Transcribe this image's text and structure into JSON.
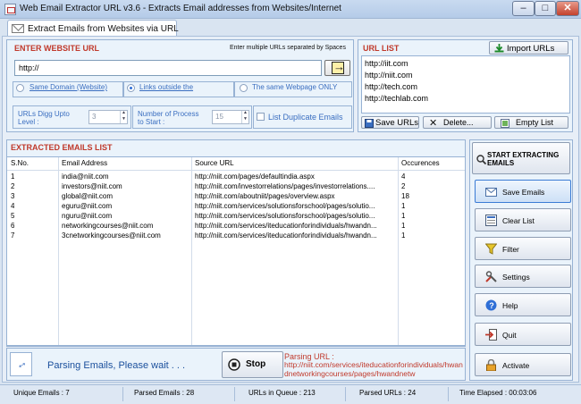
{
  "window": {
    "title": "Web Email Extractor URL v3.6 - Extracts Email addresses from Websites/Internet",
    "minimize": "–",
    "maximize": "□",
    "close": "✕"
  },
  "tab": {
    "label": "Extract Emails from Websites via URL"
  },
  "enter_url": {
    "title": "ENTER WEBSITE URL",
    "hint": "Enter multiple URLs separated by Spaces",
    "input_value": "http://",
    "radios": [
      {
        "label": "Same Domain (Website)",
        "checked": false
      },
      {
        "label": "Links outside the",
        "checked": true
      },
      {
        "label": "The same Webpage ONLY",
        "checked": false
      }
    ],
    "dig_label_1": "URLs Digg Upto",
    "dig_label_2": "Level :",
    "dig_value": "3",
    "process_label_1": "Number of Process",
    "process_label_2": "to Start :",
    "process_value": "15",
    "duplicate_label": "List Duplicate Emails"
  },
  "url_list": {
    "title": "URL LIST",
    "import_label": "Import URLs",
    "items": [
      "http://iit.com",
      "http://niit.com",
      "http://tech.com",
      "http://techlab.com"
    ],
    "save_label": "Save URLs",
    "delete_label": "Delete...",
    "empty_label": "Empty List"
  },
  "emails": {
    "title": "EXTRACTED EMAILS LIST",
    "columns": [
      "S.No.",
      "Email Address",
      "Source URL",
      "Occurences"
    ],
    "rows": [
      [
        "1",
        "india@niit.com",
        "http://niit.com/pages/defaultindia.aspx",
        "4"
      ],
      [
        "2",
        "investors@niit.com",
        "http://niit.com/investorrelations/pages/investorrelations....",
        "2"
      ],
      [
        "3",
        "global@niit.com",
        "http://niit.com/aboutniit/pages/overview.aspx",
        "18"
      ],
      [
        "4",
        "eguru@niit.com",
        "http://niit.com/services/solutionsforschool/pages/solutio...",
        "1"
      ],
      [
        "5",
        "nguru@niit.com",
        "http://niit.com/services/solutionsforschool/pages/solutio...",
        "1"
      ],
      [
        "6",
        "networkingcourses@niit.com",
        "http://niit.com/services/iteducationforindividuals/hwandn...",
        "1"
      ],
      [
        "7",
        "3cnetworkingcourses@niit.com",
        "http://niit.com/services/iteducationforindividuals/hwandn...",
        "1"
      ]
    ]
  },
  "status_panel": {
    "parsing_text": "Parsing Emails, Please wait . . .",
    "stop_label": "Stop",
    "parsing_url_label": "Parsing URL :",
    "parsing_url_value": "http://niit.com/services/iteducationforindividuals/hwandnetworkingcourses/pages/hwandnetw"
  },
  "sidebar": {
    "start_label_1": "START EXTRACTING",
    "start_label_2": "EMAILS",
    "save_emails": "Save Emails",
    "clear_list": "Clear List",
    "filter": "Filter",
    "settings": "Settings",
    "help": "Help",
    "quit": "Quit",
    "activate": "Activate"
  },
  "statusbar": {
    "unique_emails": "Unique Emails :  7",
    "parsed_emails": "Parsed Emails :  28",
    "urls_in_queue": "URLs in Queue :  213",
    "parsed_urls": "Parsed URLs :  24",
    "time_elapsed": "Time Elapsed :  00:03:06"
  },
  "colors": {
    "section_title": "#c0392b",
    "link_blue": "#3a6ec0",
    "panel_border": "#97b2d4",
    "background": "#e7eef7"
  }
}
